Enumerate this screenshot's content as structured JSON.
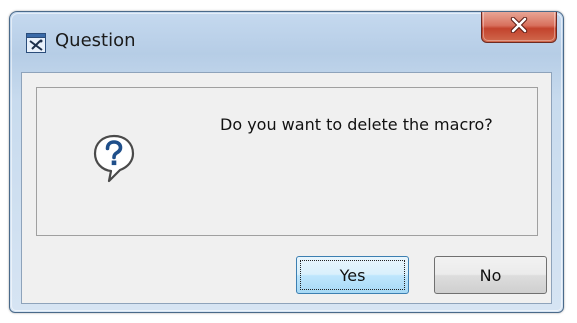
{
  "dialog": {
    "title": "Question",
    "message": "Do you want to delete the macro?",
    "icon": "question-icon"
  },
  "buttons": {
    "yes_label": "Yes",
    "no_label": "No"
  },
  "colors": {
    "accent": "#3c7fb1",
    "close_button": "#c3432d",
    "frame": "#b6cde6"
  }
}
